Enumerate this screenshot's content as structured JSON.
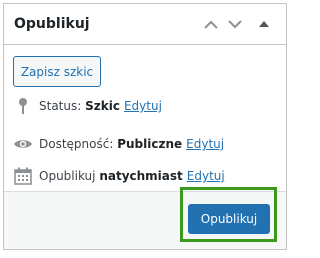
{
  "panel": {
    "title": "Opublikuj",
    "move_up_icon": "chevron-up-icon",
    "move_down_icon": "chevron-down-icon",
    "toggle_icon": "triangle-up-icon"
  },
  "save_draft_label": "Zapisz szkic",
  "status": {
    "icon": "pin-icon",
    "label": "Status:",
    "value": "Szkic",
    "edit_label": "Edytuj"
  },
  "visibility": {
    "icon": "eye-icon",
    "label": "Dostępność:",
    "value": "Publiczne",
    "edit_label": "Edytuj"
  },
  "schedule": {
    "icon": "calendar-icon",
    "label": "Opublikuj",
    "value": "natychmiast",
    "edit_label": "Edytuj"
  },
  "publish_label": "Opublikuj",
  "colors": {
    "accent": "#2271b1",
    "highlight": "#3a9a1e",
    "border": "#c3c4c7",
    "footer_bg": "#f6f7f7"
  }
}
